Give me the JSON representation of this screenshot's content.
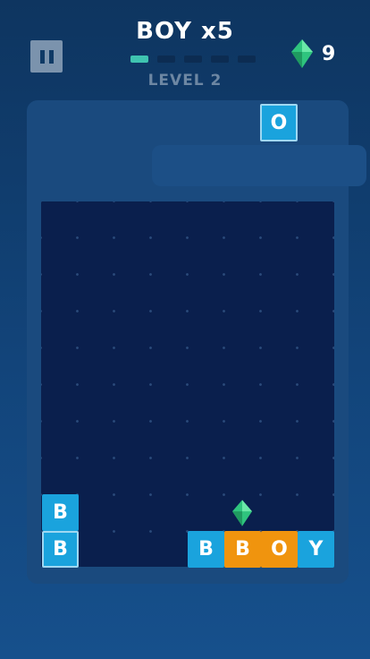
{
  "header": {
    "title": "BOY x5",
    "level": "LEVEL 2",
    "progress": {
      "filled": 1,
      "total": 5
    },
    "gems": "9"
  },
  "next_piece": {
    "letter": "O",
    "color": "#1aa3dd"
  },
  "board": {
    "stack": [
      "B",
      "B"
    ],
    "bottom_row": [
      {
        "letter": "B",
        "color": "#1aa3dd"
      },
      {
        "letter": "B",
        "color": "#f0940e"
      },
      {
        "letter": "O",
        "color": "#f0940e"
      },
      {
        "letter": "Y",
        "color": "#1aa3dd"
      }
    ]
  },
  "colors": {
    "accent": "#3fc4b0",
    "gem": "#34d48a",
    "tile_blue": "#1aa3dd",
    "tile_orange": "#f0940e"
  }
}
